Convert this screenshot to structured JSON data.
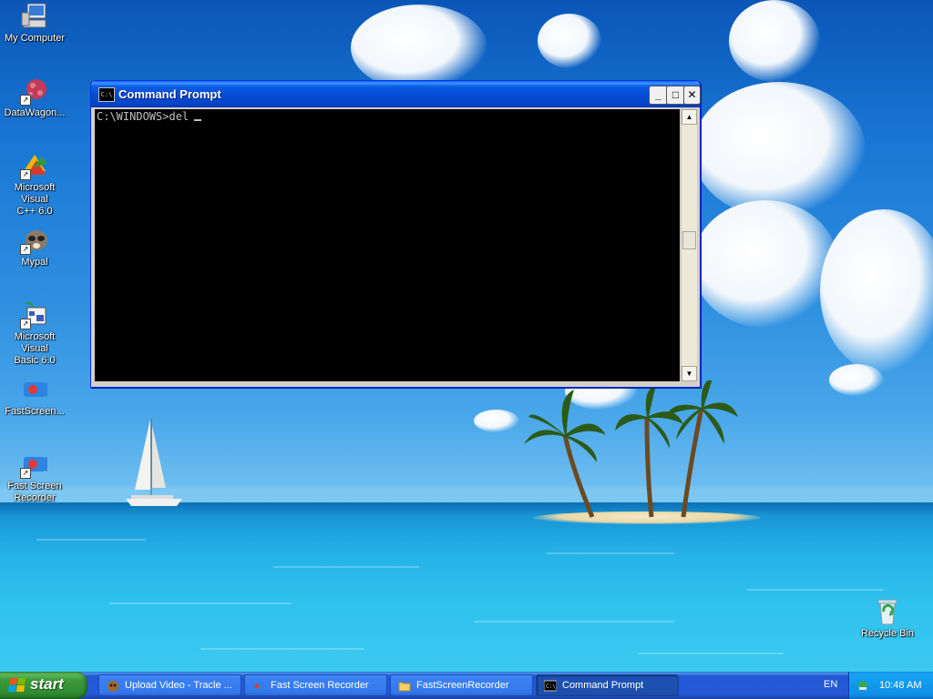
{
  "desktop": {
    "icons": [
      {
        "label": "My Computer",
        "icon": "my-computer-icon"
      },
      {
        "label": "DataWagon...",
        "icon": "datawagon-icon"
      },
      {
        "label": "Microsoft Visual\nC++ 6.0",
        "icon": "visual-cpp-icon"
      },
      {
        "label": "Mypal",
        "icon": "mypal-icon"
      },
      {
        "label": "Microsoft Visual\nBasic 6.0",
        "icon": "visual-basic-icon"
      },
      {
        "label": "FastScreen...",
        "icon": "fastscreen-icon"
      },
      {
        "label": "Fast Screen\nRecorder",
        "icon": "fast-screen-recorder-icon"
      },
      {
        "label": "Recycle Bin",
        "icon": "recycle-bin-icon"
      }
    ]
  },
  "cmd_window": {
    "title": "Command Prompt",
    "title_icon_text": "C:\\",
    "console_line": "C:\\WINDOWS>del",
    "buttons": {
      "minimize": "_",
      "maximize": "□",
      "close": "✕"
    },
    "scroll_up": "▲",
    "scroll_down": "▼"
  },
  "taskbar": {
    "start_label": "start",
    "tasks": [
      {
        "label": "Upload Video - Tracle ...",
        "icon": "browser-icon",
        "active": false
      },
      {
        "label": "Fast Screen Recorder",
        "icon": "recorder-icon",
        "active": false
      },
      {
        "label": "FastScreenRecorder",
        "icon": "folder-icon",
        "active": false
      },
      {
        "label": "Command Prompt",
        "icon": "cmd-icon",
        "active": true
      }
    ],
    "language": "EN",
    "clock": "10:48 AM"
  },
  "colors": {
    "titlebar_blue": "#0548d1",
    "taskbar_blue": "#2459d6",
    "start_green": "#3b9b3b",
    "console_bg": "#000000",
    "console_text": "#c0c0c0"
  }
}
